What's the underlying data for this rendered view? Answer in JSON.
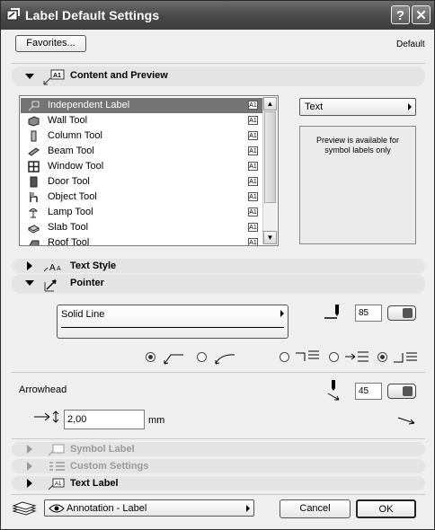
{
  "window": {
    "title": "Label Default Settings",
    "help_glyph": "?",
    "close_glyph": "✕"
  },
  "top": {
    "favorites_label": "Favorites...",
    "default_label": "Default"
  },
  "sections": {
    "content_preview": "Content and Preview",
    "text_style": "Text Style",
    "pointer": "Pointer",
    "symbol_label": "Symbol Label",
    "custom_settings": "Custom Settings",
    "text_label": "Text Label"
  },
  "tool_list": [
    {
      "label": "Independent Label",
      "icon": "label-icon",
      "selected": true
    },
    {
      "label": "Wall Tool",
      "icon": "wall-icon"
    },
    {
      "label": "Column Tool",
      "icon": "column-icon"
    },
    {
      "label": "Beam Tool",
      "icon": "beam-icon"
    },
    {
      "label": "Window Tool",
      "icon": "window-icon"
    },
    {
      "label": "Door Tool",
      "icon": "door-icon"
    },
    {
      "label": "Object Tool",
      "icon": "object-icon"
    },
    {
      "label": "Lamp Tool",
      "icon": "lamp-icon"
    },
    {
      "label": "Slab Tool",
      "icon": "slab-icon"
    },
    {
      "label": "Roof Tool",
      "icon": "roof-icon"
    }
  ],
  "badge_text": "A1",
  "text_select": "Text",
  "preview_note": "Preview is available for symbol labels only",
  "pointer": {
    "line_type": "Solid Line",
    "pen_number": "85",
    "arrowhead_label": "Arrowhead",
    "arrow_pen": "45",
    "size_value": "2,00",
    "size_unit": "mm",
    "selected_shape_index": 0,
    "selected_anchor_index": 2
  },
  "bottom": {
    "layer_label": "Annotation - Label",
    "cancel_label": "Cancel",
    "ok_label": "OK"
  }
}
